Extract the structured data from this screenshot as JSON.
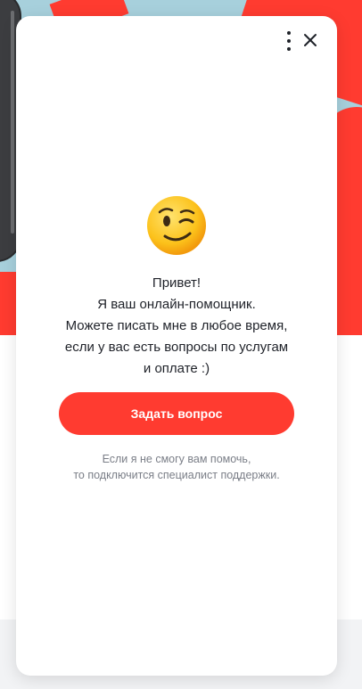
{
  "widget": {
    "greeting_lines": [
      "Привет!",
      "Я ваш онлайн-помощник.",
      "Можете писать мне в любое время,",
      "если у вас есть вопросы по услугам",
      "и оплате :)"
    ],
    "ask_button_label": "Задать вопрос",
    "note_lines": [
      "Если я не смогу вам помочь,",
      "то подключится специалист поддержки."
    ],
    "emoji": "winking-face-icon",
    "menu_icon": "more-vertical-icon",
    "close_icon": "close-icon"
  },
  "colors": {
    "accent": "#ff3b30",
    "background_blue": "#a7d0dc",
    "text_primary": "#1f2229",
    "text_secondary": "#7a7e87"
  }
}
